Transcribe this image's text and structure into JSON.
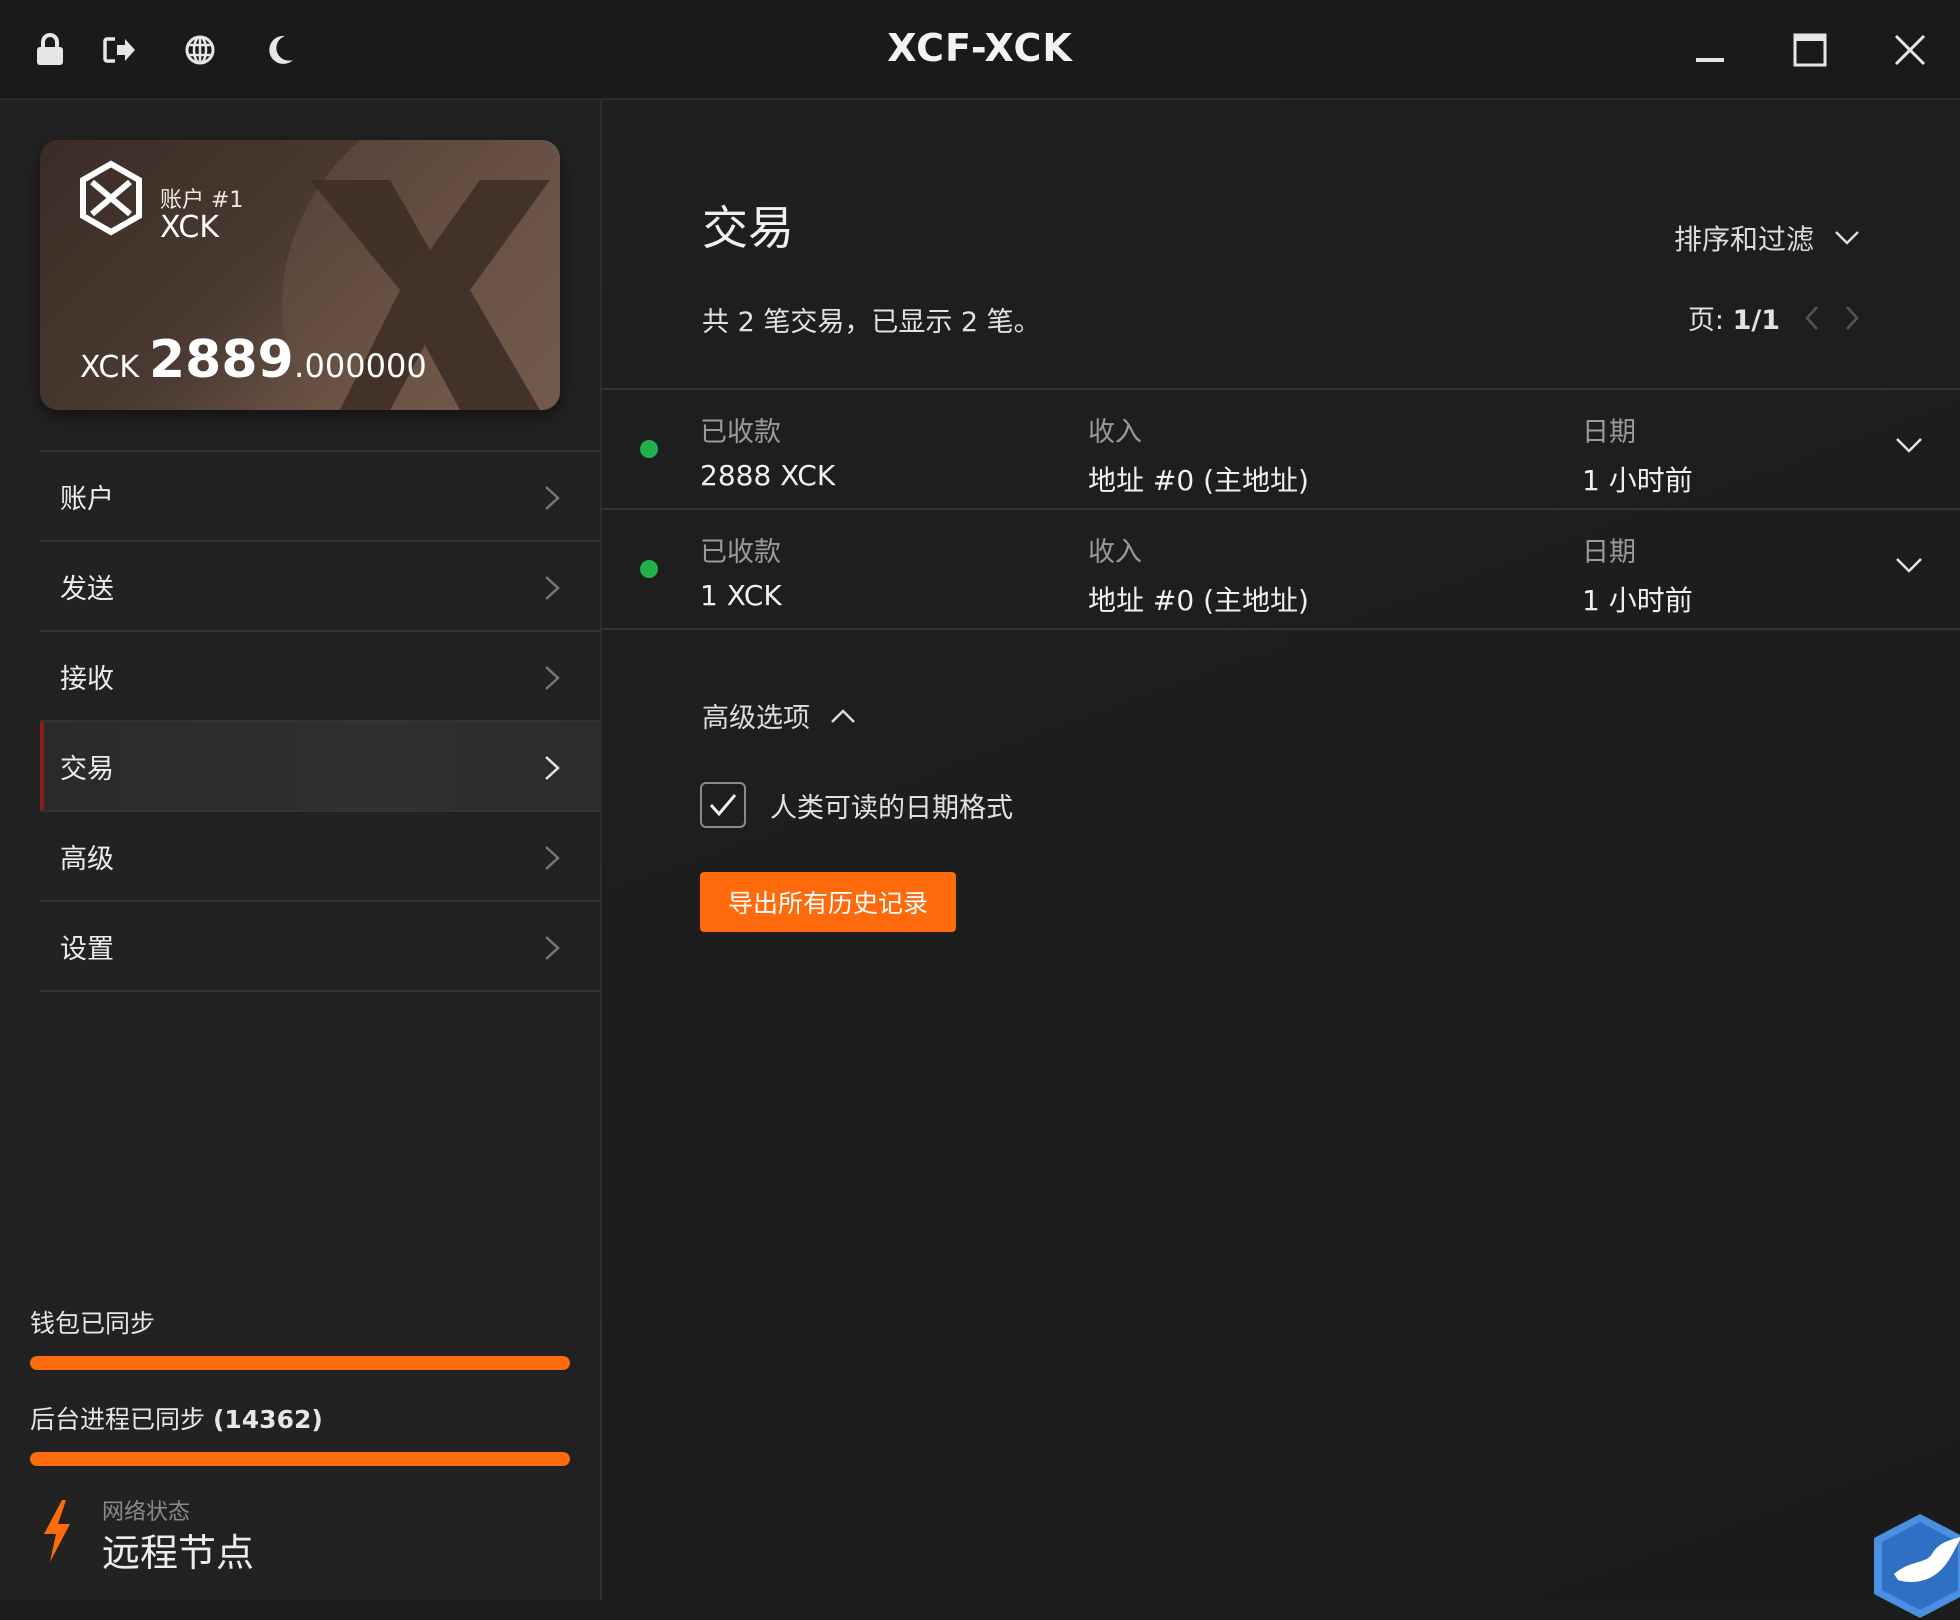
{
  "app": {
    "title": "XCF-XCK"
  },
  "titlebar": {
    "icons": [
      "lock-icon",
      "logout-icon",
      "globe-icon",
      "moon-icon"
    ],
    "window_controls": [
      "minimize-icon",
      "maximize-icon",
      "close-icon"
    ]
  },
  "account_card": {
    "label": "账户 #1",
    "name": "XCK",
    "currency": "XCK",
    "balance_int": "2889",
    "balance_dot": ".",
    "balance_dec": "000000"
  },
  "sidebar": {
    "items": [
      {
        "label": "账户",
        "active": false
      },
      {
        "label": "发送",
        "active": false
      },
      {
        "label": "接收",
        "active": false
      },
      {
        "label": "交易",
        "active": true
      },
      {
        "label": "高级",
        "active": false
      },
      {
        "label": "设置",
        "active": false
      }
    ],
    "wallet_sync": {
      "label": "钱包已同步",
      "progress": 1.0
    },
    "daemon_sync": {
      "label_prefix": "后台进程已同步 ",
      "label_count": "(14362)",
      "progress": 1.0
    },
    "network": {
      "label": "网络状态",
      "value": "远程节点"
    }
  },
  "main": {
    "title": "交易",
    "sort_filter": "排序和过滤",
    "summary": "共 2 笔交易，已显示 2 笔。",
    "pager": {
      "label": "页:",
      "value": "1/1"
    },
    "transactions": [
      {
        "status_label": "已收款",
        "amount": "2888 XCK",
        "type_label": "收入",
        "address": "地址 #0 (主地址)",
        "date_label": "日期",
        "date": "1 小时前"
      },
      {
        "status_label": "已收款",
        "amount": "1 XCK",
        "type_label": "收入",
        "address": "地址 #0 (主地址)",
        "date_label": "日期",
        "date": "1 小时前"
      }
    ],
    "advanced": {
      "toggle_label": "高级选项",
      "checkbox_label": "人类可读的日期格式",
      "checkbox_checked": true,
      "export_button": "导出所有历史记录"
    }
  },
  "colors": {
    "accent": "#ff6a0d",
    "status_green": "#22b14c",
    "active_marker": "#8b1e1e",
    "background": "#1c1c1c"
  }
}
